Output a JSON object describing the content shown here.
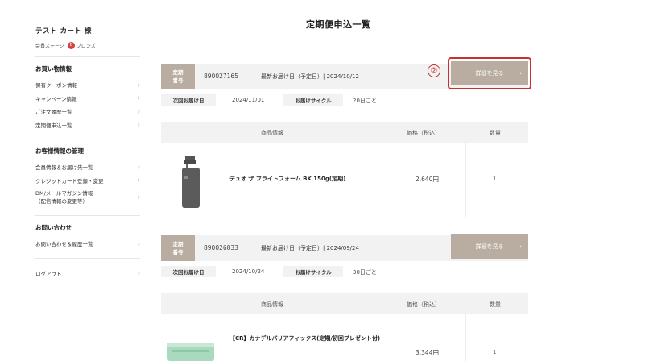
{
  "page_title": "定期便申込一覧",
  "sidebar": {
    "user_name": "テスト カート 様",
    "rank_label": "会員ステージ",
    "rank_value": "ブロンズ",
    "sections": [
      {
        "heading": "お買い物情報",
        "items": [
          "保有クーポン情報",
          "キャンペーン情報",
          "ご注文履歴一覧",
          "定期便申込一覧"
        ]
      },
      {
        "heading": "お客様情報の管理",
        "items": [
          "会員情報＆お届け先一覧",
          "クレジットカード登録・変更",
          "DM/メールマガジン情報\n（配信情報の変更等）"
        ]
      },
      {
        "heading": "お問い合わせ",
        "items": [
          "お問い合わせ＆履歴一覧"
        ]
      }
    ],
    "logout": "ログアウト"
  },
  "labels": {
    "order_badge": "定期\n番号",
    "next_delivery": "次回お届け日",
    "cycle": "お届けサイクル",
    "detail_button": "詳細を見る",
    "col_product": "商品情報",
    "col_price": "価格（税込）",
    "col_qty": "数量"
  },
  "annotation": "②",
  "orders": [
    {
      "number": "890027165",
      "latest_delivery": "最新お届け日（予定日）| 2024/10/12",
      "next_date": "2024/11/01",
      "cycle_value": "20日ごと",
      "product": "デュオ ザ ブライトフォーム BK 150g(定期)",
      "price": "2,640円",
      "qty": "1"
    },
    {
      "number": "890026833",
      "latest_delivery": "最新お届け日（予定日）| 2024/09/24",
      "next_date": "2024/10/24",
      "cycle_value": "30日ごと",
      "product": "【CR】カナデルバリアフィックス(定期/初回プレゼント付)",
      "price": "3,344円",
      "qty": "1"
    }
  ]
}
